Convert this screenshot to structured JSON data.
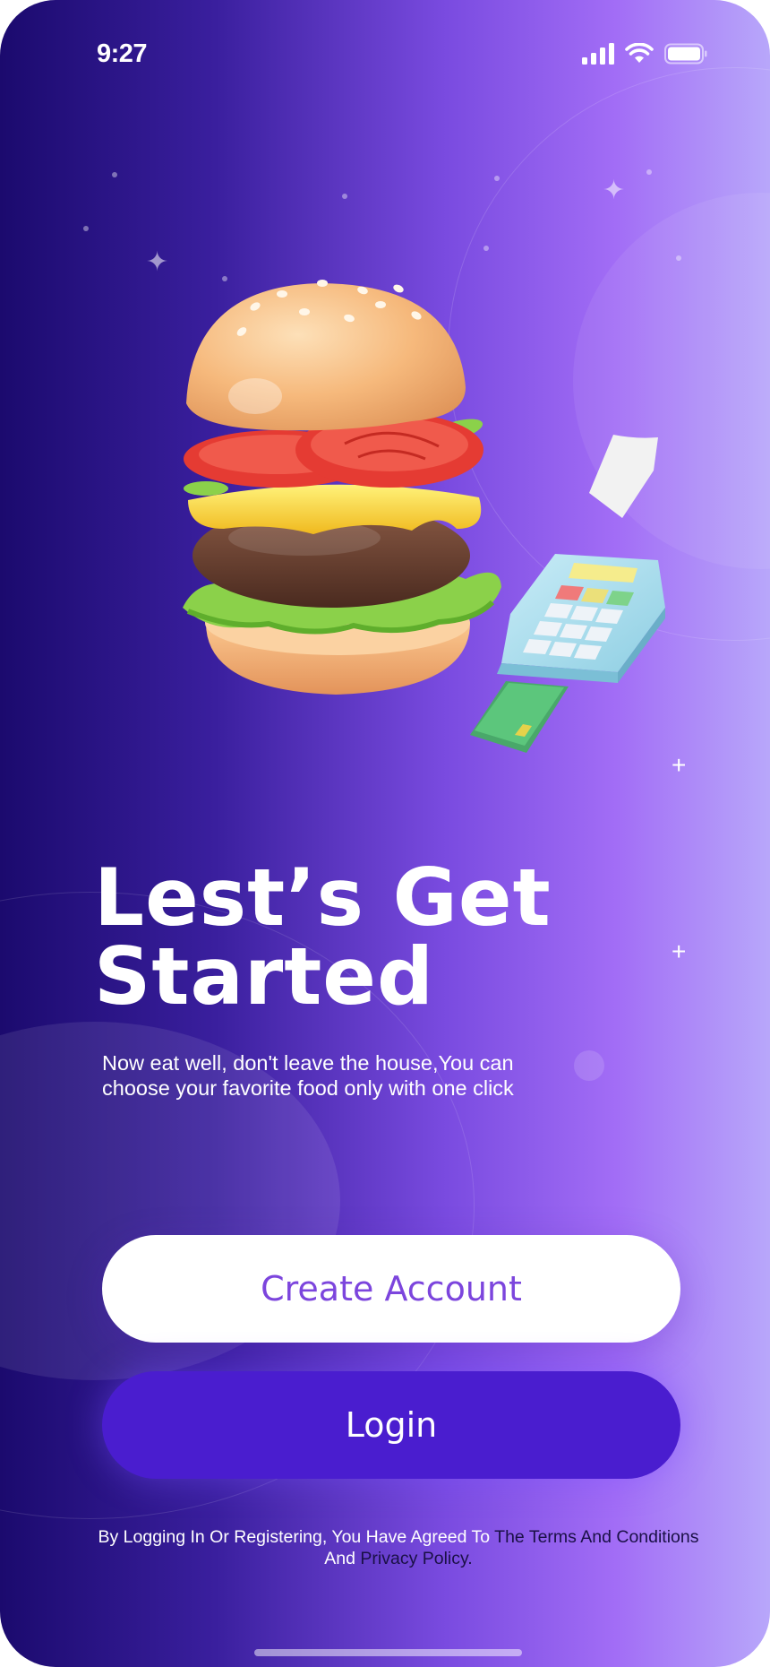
{
  "status_bar": {
    "time": "9:27",
    "icons": [
      "signal-icon",
      "wifi-icon",
      "battery-icon"
    ]
  },
  "hero": {
    "illustration": [
      "burger-icon",
      "card-terminal-icon"
    ]
  },
  "headline": {
    "line1": "Lest’s Get",
    "line2": "Started"
  },
  "subtitle": "Now eat well, don't leave the house,You can choose your favorite food only with one click",
  "buttons": {
    "create_account": "Create Account",
    "login": "Login"
  },
  "legal": {
    "prefix": "By Logging In Or Registering, You Have Agreed To ",
    "terms_link": "The Terms And Conditions",
    "connector": " And ",
    "privacy_link": "Privacy Policy."
  },
  "colors": {
    "accent": "#7c45dd",
    "login_button": "#4a1dcf",
    "gradient_start": "#1b0a6e",
    "gradient_end": "#b8a7fa"
  }
}
